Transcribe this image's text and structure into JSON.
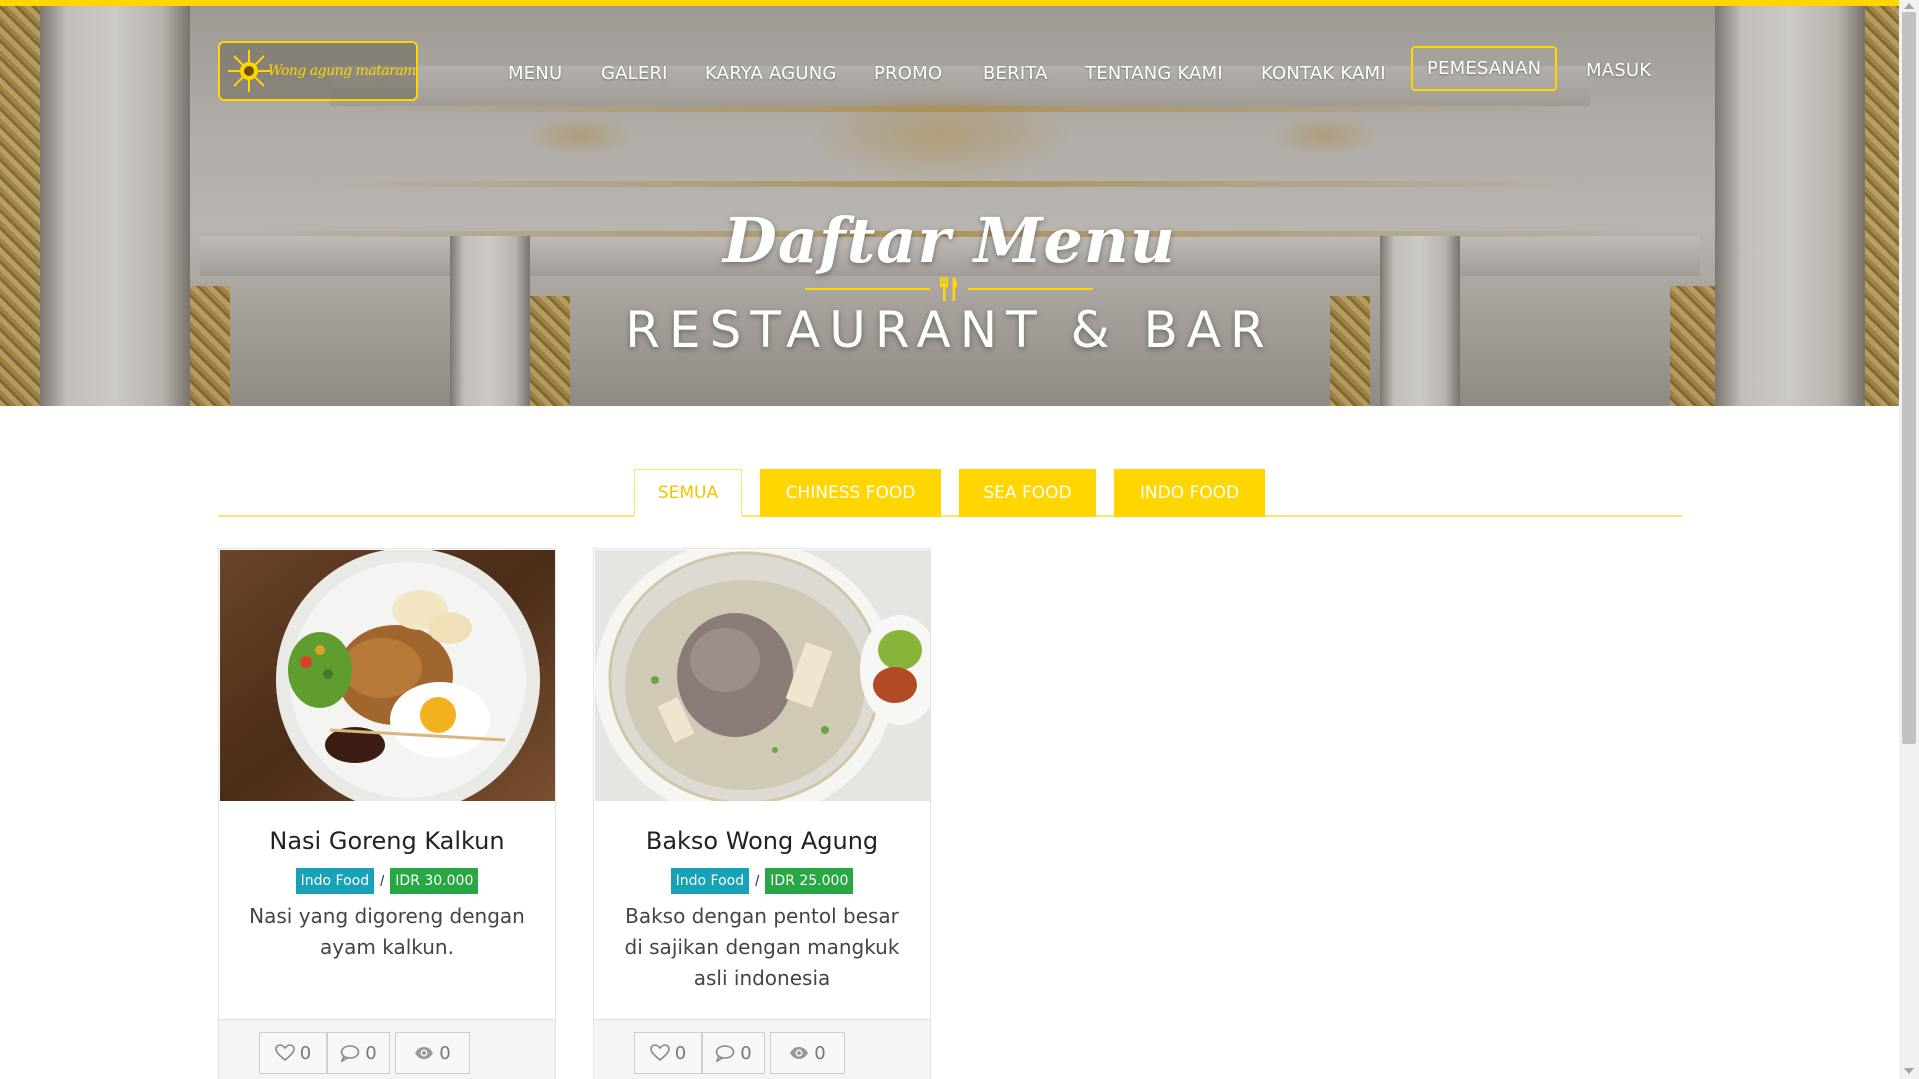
{
  "brand": {
    "logo_text": "Wong agung mataram"
  },
  "nav": {
    "items": [
      "MENU",
      "GALERI",
      "KARYA AGUNG",
      "PROMO",
      "BERITA",
      "TENTANG KAMI",
      "KONTAK KAMI"
    ],
    "order_button": "PEMESANAN",
    "login": "MASUK"
  },
  "hero": {
    "title": "Daftar Menu",
    "subtitle": "RESTAURANT & BAR"
  },
  "tabs": [
    {
      "label": "SEMUA",
      "active": true
    },
    {
      "label": "CHINESS FOOD",
      "active": false
    },
    {
      "label": "SEA FOOD",
      "active": false
    },
    {
      "label": "INDO FOOD",
      "active": false
    }
  ],
  "menu_items": [
    {
      "name": "Nasi Goreng Kalkun",
      "category": "Indo Food",
      "separator": "/",
      "price": "IDR 30.000",
      "description": "Nasi yang digoreng dengan ayam kalkun.",
      "likes": "0",
      "comments": "0",
      "views": "0"
    },
    {
      "name": "Bakso Wong Agung",
      "category": "Indo Food",
      "separator": "/",
      "price": "IDR 25.000",
      "description": "Bakso dengan pentol besar di sajikan dengan mangkuk asli indonesia",
      "likes": "0",
      "comments": "0",
      "views": "0"
    }
  ],
  "colors": {
    "accent_yellow": "#ffd600",
    "badge_category": "#17a2b8",
    "badge_price": "#28a745"
  }
}
